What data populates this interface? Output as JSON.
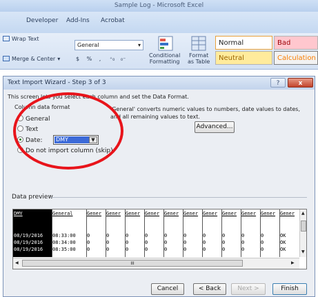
{
  "excel": {
    "title": "Sample Log - Microsoft Excel",
    "tabs": [
      "Developer",
      "Add-Ins",
      "Acrobat"
    ],
    "wrap_text": "Wrap Text",
    "merge_center": "Merge & Center",
    "number_format": "General",
    "number_symbols": [
      "$",
      "%",
      ","
    ],
    "conditional_formatting": "Conditional\nFormatting",
    "format_as_table": "Format\nas Table",
    "styles": {
      "normal": "Normal",
      "bad": "Bad",
      "neutral": "Neutral",
      "calculation": "Calculation"
    }
  },
  "dialog": {
    "title": "Text Import Wizard - Step 3 of 3",
    "help_glyph": "?",
    "close_glyph": "x",
    "intro": "This screen lets you select each column and set the Data Format.",
    "column_format_label": "Column data format",
    "options": [
      "General",
      "Text",
      "Date:",
      "Do not import column (skip)"
    ],
    "date_format": "DMY",
    "general_description": "'General' converts numeric values to numbers, date values to dates, and all remaining values to text.",
    "advanced_button": "Advanced...",
    "preview_label": "Data preview",
    "preview_headers": [
      "DMY",
      "General",
      "Gener",
      "Gener",
      "Gener",
      "Gener",
      "Gener",
      "Gener",
      "Gener",
      "Gener",
      "Gener",
      "Gener",
      "Gener",
      "Gener"
    ],
    "preview_rows": [
      [
        "08/19/2016",
        "08:33:00",
        "0",
        "0",
        "0",
        "0",
        "0",
        "0",
        "0",
        "0",
        "0",
        "0",
        "OK",
        "OK"
      ],
      [
        "08/19/2016",
        "08:34:00",
        "0",
        "0",
        "0",
        "0",
        "0",
        "0",
        "0",
        "0",
        "0",
        "0",
        "OK",
        "OK"
      ],
      [
        "08/19/2016",
        "08:35:00",
        "0",
        "0",
        "0",
        "0",
        "0",
        "0",
        "0",
        "0",
        "0",
        "0",
        "OK",
        "OK"
      ]
    ],
    "buttons": {
      "cancel": "Cancel",
      "back": "< Back",
      "next": "Next >",
      "finish": "Finish"
    },
    "scroll_grip": "III"
  },
  "colors": {
    "annotation_circle": "#e8141b",
    "style_bad_bg": "#ffc7ce",
    "style_neutral_bg": "#ffeb9c",
    "style_calc_bg": "#f2f2f2"
  }
}
